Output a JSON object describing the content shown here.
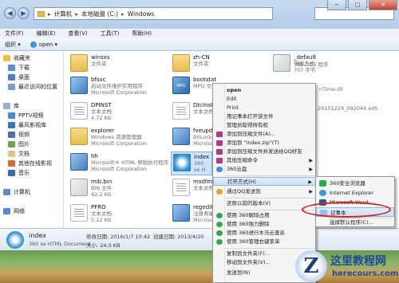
{
  "titlebar": {
    "address": [
      "计算机",
      "本地磁盘 (C:)",
      "Windows"
    ]
  },
  "menubar": [
    "文件(F)",
    "编辑(E)",
    "查看(V)",
    "工具(T)",
    "帮助(H)"
  ],
  "toolbar": {
    "organize": "组织 ▾",
    "open": "open ▾"
  },
  "nav": {
    "favorites": [
      "收藏夹",
      "下载",
      "桌面",
      "最近访问的位置"
    ],
    "library_header": "库",
    "libraries": [
      "PPTV视频",
      "暴风影视库",
      "视频",
      "图片",
      "文档",
      "其他在线影视",
      "音乐"
    ],
    "computer": "计算机",
    "network": "网络"
  },
  "files": [
    {
      "name": "winsxs",
      "sub1": "文件夹",
      "sub2": "",
      "kind": "folder"
    },
    {
      "name": "bfsvc",
      "sub1": "启动文件维护实用程序",
      "sub2": "Microsoft Corporation",
      "kind": "exe"
    },
    {
      "name": "DPINST",
      "sub1": "文本文档",
      "sub2": "4.72 KB",
      "kind": "doc"
    },
    {
      "name": "explorer",
      "sub1": "Windows 资源管理器",
      "sub2": "Microsoft Corporation",
      "kind": "folder"
    },
    {
      "name": "hh",
      "sub1": "Microsoft® HTML 帮助执行程序",
      "sub2": "Microsoft Corporation",
      "kind": "exe"
    },
    {
      "name": "mib.bin",
      "sub1": "BIN 文件",
      "sub2": "42.2 KB",
      "kind": "dll"
    },
    {
      "name": "PFRO",
      "sub1": "文本文档",
      "sub2": "5.12 KB",
      "kind": "doc"
    },
    {
      "name": "zh-CN",
      "sub1": "文件夹",
      "sub2": "",
      "kind": "folder"
    },
    {
      "name": "bootstat",
      "sub1": "MPG 文件",
      "sub2": "",
      "kind": "mpg"
    },
    {
      "name": "DtcInsta",
      "sub1": "文本文档",
      "sub2": "",
      "kind": "doc"
    },
    {
      "name": "fveupda",
      "sub1": "BitLocke",
      "sub2": "Microsof",
      "kind": "exe"
    },
    {
      "name": "index",
      "sub1": "360 se H",
      "sub2": "",
      "kind": "ie"
    },
    {
      "name": "msdfma",
      "sub1": "文本文档",
      "sub2": "",
      "kind": "doc"
    },
    {
      "name": "regedit",
      "sub1": "注册表编辑",
      "sub2": "Microsof",
      "kind": "exe"
    },
    {
      "name": "_default",
      "sub1": "快捷方式",
      "sub2": "707 字节",
      "kind": "dll"
    },
    {
      "name": "MS-DOS 程序",
      "sub1": "",
      "sub2": "",
      "kind": "none"
    },
    {
      "name": "nTime.dll",
      "sub1": "",
      "sub2": "",
      "kind": "none"
    },
    {
      "name": "20151229_092044.ed5",
      "sub1": "",
      "sub2": "",
      "kind": "none"
    }
  ],
  "context_menu": [
    {
      "label": "open",
      "bold": true
    },
    {
      "label": "Edit"
    },
    {
      "label": "Print"
    },
    {
      "label": "用记事本打开该文件"
    },
    {
      "label": "管理员取得所有权"
    },
    {
      "label": "添加到压缩文件(A)..."
    },
    {
      "label": "添加到 \"index.zip\"(T)"
    },
    {
      "label": "添加到压缩文件并发送给QQ好友"
    },
    {
      "label": "其他压缩命令"
    },
    {
      "label": "360云盘"
    },
    {
      "label": "打开方式(H)",
      "highlight": true
    },
    {
      "label": "通过QQ发送到"
    },
    {
      "label": "还原以前的版本(V)"
    },
    {
      "label": "使用 360解除占用"
    },
    {
      "label": "使用 360强力删除"
    },
    {
      "label": "使用 360进行木马云查杀"
    },
    {
      "label": "使用 360管理右键菜单"
    },
    {
      "label": "复制到文件夹(F)..."
    },
    {
      "label": "移动到文件夹(V)..."
    },
    {
      "label": "发送到(N)"
    }
  ],
  "submenu": [
    {
      "label": "360安全浏览器"
    },
    {
      "label": "Internet Explorer"
    },
    {
      "label": "Microsoft Word"
    },
    {
      "label": "记事本",
      "highlight": true
    },
    {
      "label": "选择默认程序(C)..."
    }
  ],
  "details": {
    "name": "index",
    "type": "360 se HTML Document",
    "modified": "修改日期: 2016/1/7 10:42",
    "size": "大小: 24.0 KB",
    "created": "创建日期: 2013/4/20"
  },
  "watermark": {
    "title": "这里教程网",
    "url": "herecours.com",
    "logo": "Z"
  },
  "colors": {
    "accent": "#d9221b",
    "selection": "#cde5fb",
    "brand": "#1f4a9c"
  }
}
